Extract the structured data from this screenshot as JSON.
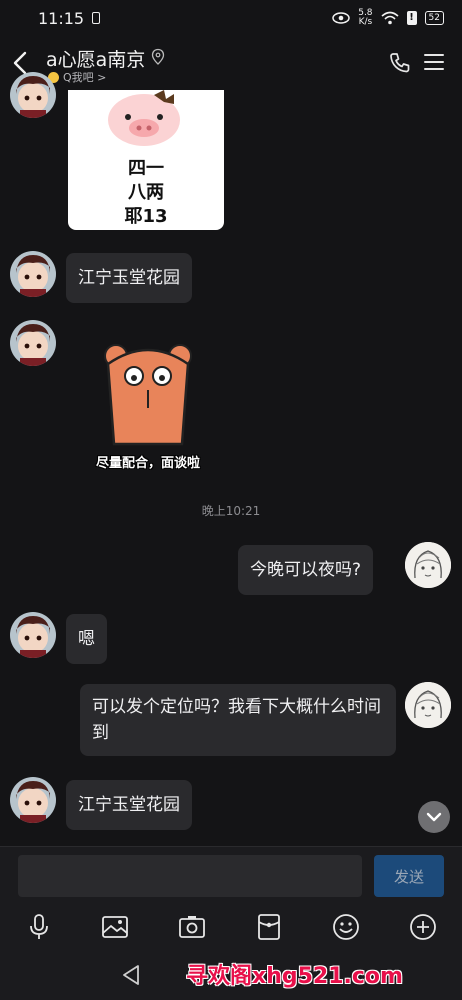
{
  "status_bar": {
    "time": "11:15",
    "net_speed": "5.8",
    "net_unit": "K/s",
    "battery": "52"
  },
  "header": {
    "title": "a心愿a南京",
    "subtitle": "Q我吧 >"
  },
  "stickers": {
    "pig": {
      "lines": [
        "四一",
        "八两",
        "耶13"
      ]
    },
    "bear": {
      "caption": "尽量配合，面谈啦"
    }
  },
  "messages": [
    {
      "side": "in",
      "text": "江宁玉堂花园"
    },
    {
      "side": "out",
      "text": "今晚可以夜吗?"
    },
    {
      "side": "in",
      "text": "嗯"
    },
    {
      "side": "out",
      "text": "可以发个定位吗？我看下大概什么时间到"
    },
    {
      "side": "in",
      "text": "江宁玉堂花园"
    }
  ],
  "time_separator": "晚上10:21",
  "composer": {
    "value": "",
    "send_label": "发送"
  },
  "toolbar": {
    "icons": [
      "mic-icon",
      "image-icon",
      "camera-icon",
      "red-packet-icon",
      "emoji-icon",
      "plus-icon"
    ]
  },
  "nav": {
    "watermark": "寻欢阁xhg521.com"
  }
}
